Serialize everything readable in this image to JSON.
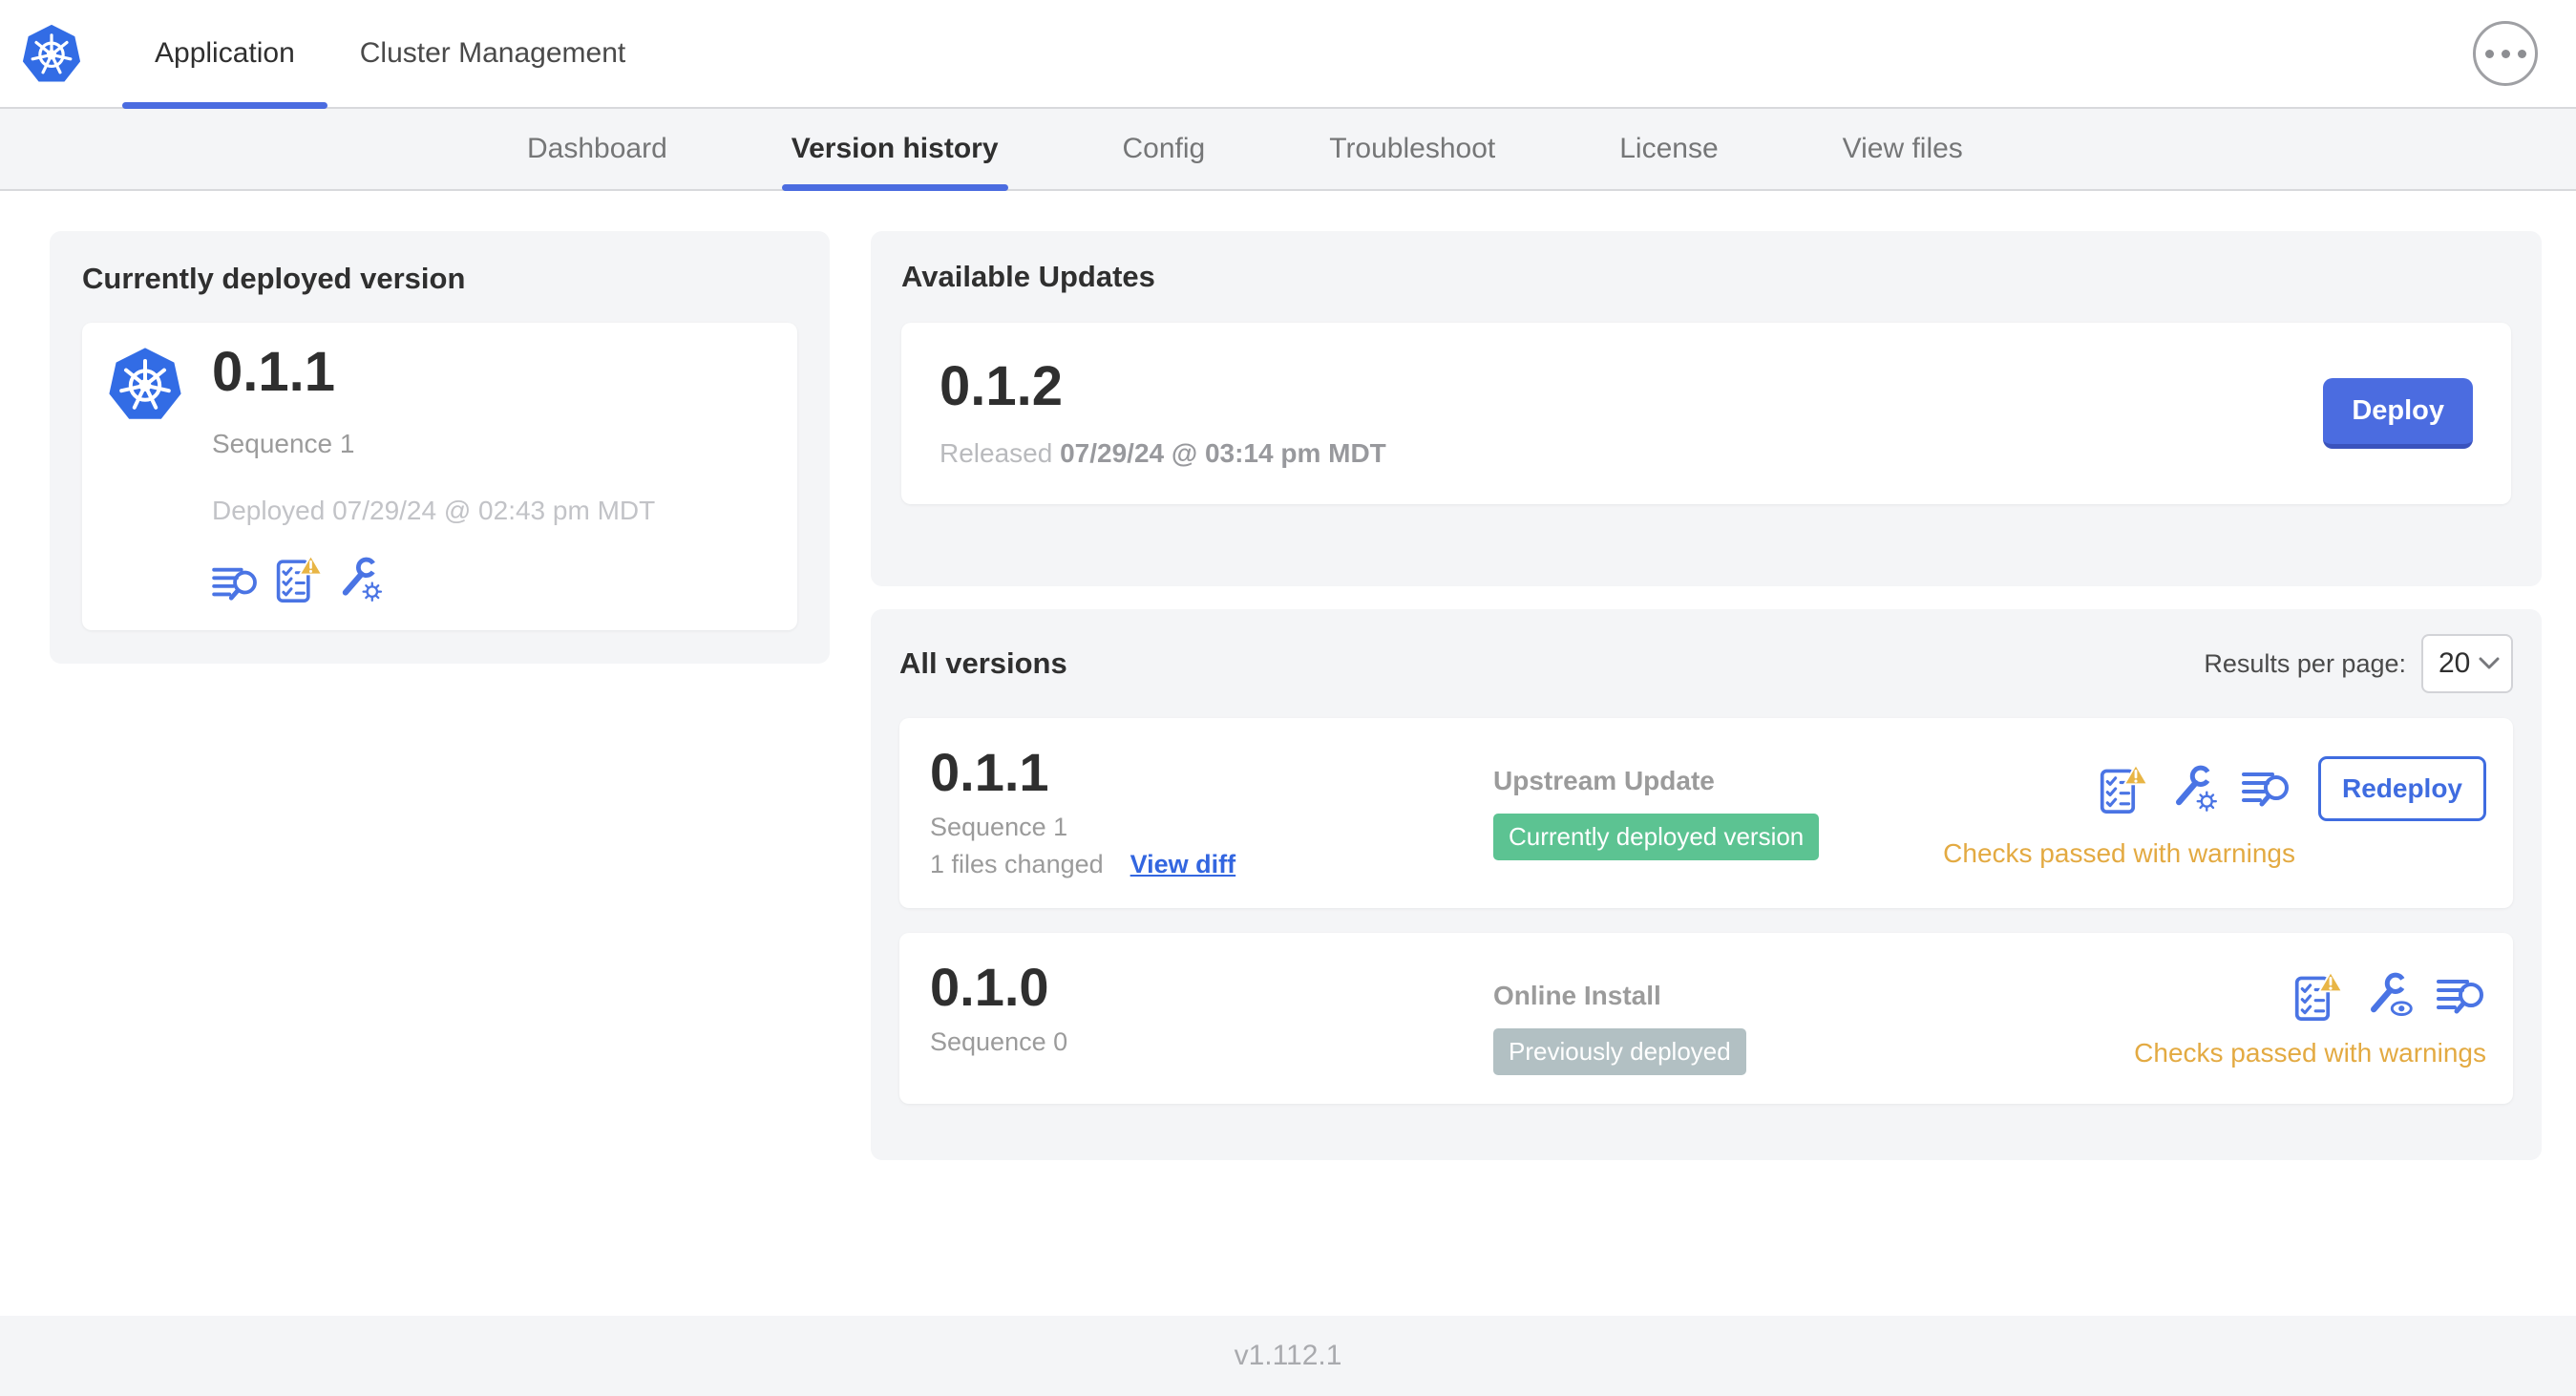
{
  "header": {
    "tabs": [
      {
        "label": "Application",
        "active": true
      },
      {
        "label": "Cluster Management",
        "active": false
      }
    ]
  },
  "subnav": {
    "tabs": [
      "Dashboard",
      "Version history",
      "Config",
      "Troubleshoot",
      "License",
      "View files"
    ],
    "active_tab": "Version history"
  },
  "current_version": {
    "section_title": "Currently deployed version",
    "version": "0.1.1",
    "sequence": "Sequence 1",
    "deployed_at": "Deployed 07/29/24 @ 02:43 pm MDT",
    "icons": [
      "release-notes-icon",
      "preflight-checks-warning-icon",
      "config-wrench-gear-icon"
    ]
  },
  "available_updates": {
    "section_title": "Available Updates",
    "version": "0.1.2",
    "released_prefix": "Released",
    "released_at": "07/29/24 @ 03:14 pm MDT",
    "deploy_button": "Deploy"
  },
  "all_versions": {
    "section_title": "All versions",
    "results_per_page_label": "Results per page:",
    "results_per_page_value": "20",
    "rows": [
      {
        "version": "0.1.1",
        "sequence": "Sequence 1",
        "files_changed": "1 files changed",
        "view_diff": "View diff",
        "source": "Upstream Update",
        "status_badge": "Currently deployed version",
        "badge_color": "#5cc392",
        "action_button": "Redeploy",
        "preflight_status": "Checks passed with warnings",
        "icons": [
          "preflight-checks-warning-icon",
          "config-wrench-gear-icon",
          "release-notes-icon"
        ]
      },
      {
        "version": "0.1.0",
        "sequence": "Sequence 0",
        "source": "Online Install",
        "status_badge": "Previously deployed",
        "badge_color": "#b2c0c3",
        "preflight_status": "Checks passed with warnings",
        "icons": [
          "preflight-checks-warning-icon",
          "config-wrench-eye-icon",
          "release-notes-icon"
        ]
      }
    ]
  },
  "footer": {
    "app_version": "v1.112.1"
  },
  "colors": {
    "k8s_blue": "#326ce5",
    "primary_button_blue": "#4b6ce0",
    "link_blue": "#3366e0",
    "icon_blue": "#4a74e4",
    "success_green": "#5cc392",
    "muted_badge_gray": "#b2c0c3",
    "warning_amber": "#e3aa42",
    "panel_gray": "#f4f5f7"
  }
}
